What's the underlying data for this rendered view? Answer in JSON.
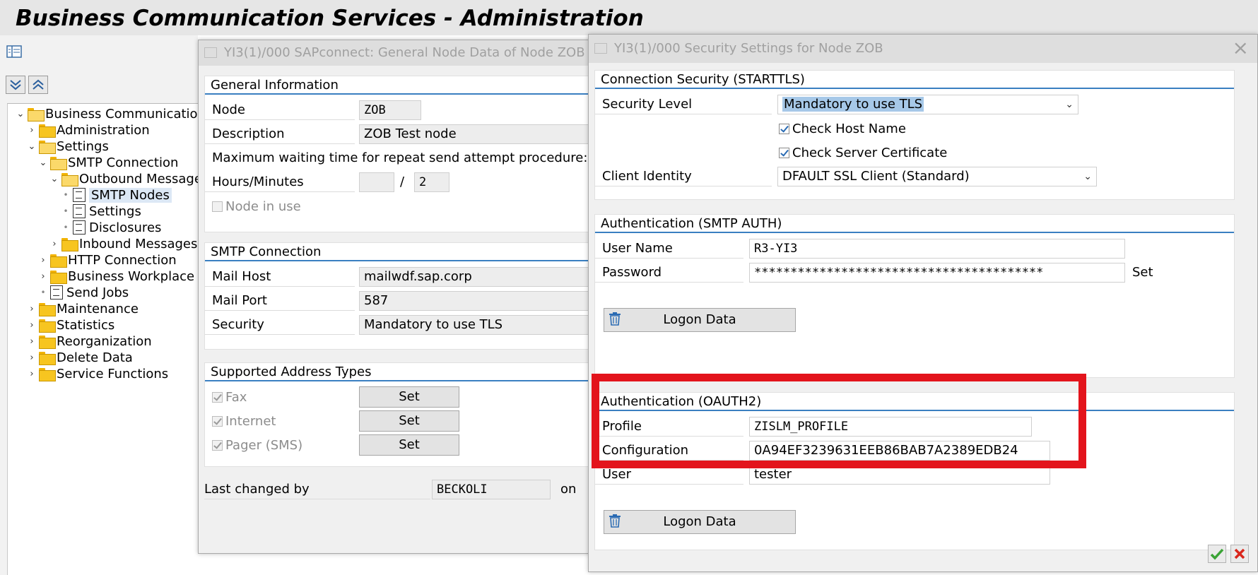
{
  "app": {
    "title": "Business Communication Services - Administration"
  },
  "tree": {
    "items": [
      {
        "label": "Business Communication",
        "toggle": "⌄",
        "icon": "folder-open-icon"
      },
      {
        "label": "Administration",
        "toggle": "›",
        "icon": "folder-icon"
      },
      {
        "label": "Settings",
        "toggle": "⌄",
        "icon": "folder-open-icon"
      },
      {
        "label": "SMTP Connection",
        "toggle": "⌄",
        "icon": "folder-open-icon"
      },
      {
        "label": "Outbound Messages",
        "toggle": "⌄",
        "icon": "folder-open-icon"
      },
      {
        "label": "SMTP Nodes",
        "toggle": "•",
        "icon": "document-icon"
      },
      {
        "label": "Settings",
        "toggle": "•",
        "icon": "document-icon"
      },
      {
        "label": "Disclosures",
        "toggle": "•",
        "icon": "document-icon"
      },
      {
        "label": "Inbound Messages",
        "toggle": "›",
        "icon": "folder-icon"
      },
      {
        "label": "HTTP Connection",
        "toggle": "›",
        "icon": "folder-icon"
      },
      {
        "label": "Business Workplace",
        "toggle": "›",
        "icon": "folder-icon"
      },
      {
        "label": "Send Jobs",
        "toggle": "•",
        "icon": "document-icon"
      },
      {
        "label": "Maintenance",
        "toggle": "›",
        "icon": "folder-icon"
      },
      {
        "label": "Statistics",
        "toggle": "›",
        "icon": "folder-icon"
      },
      {
        "label": "Reorganization",
        "toggle": "›",
        "icon": "folder-icon"
      },
      {
        "label": "Delete Data",
        "toggle": "›",
        "icon": "folder-icon"
      },
      {
        "label": "Service Functions",
        "toggle": "›",
        "icon": "folder-icon"
      }
    ]
  },
  "node_dialog": {
    "title": "YI3(1)/000 SAPconnect: General Node Data of Node ZOB",
    "general": {
      "title": "General Information",
      "node_label": "Node",
      "node_value": "ZOB",
      "description_label": "Description",
      "description_value": "ZOB Test node",
      "max_wait_text": "Maximum waiting time for repeat send attempt procedure:",
      "hours_minutes_label": "Hours/Minutes",
      "hours_value": "",
      "separator": "/",
      "minutes_value": "2",
      "node_in_use_label": "Node in use"
    },
    "smtp": {
      "title": "SMTP Connection",
      "mail_host_label": "Mail Host",
      "mail_host_value": "mailwdf.sap.corp",
      "mail_port_label": "Mail Port",
      "mail_port_value": "587",
      "security_label": "Security",
      "security_value": "Mandatory to use TLS"
    },
    "address_types": {
      "title": "Supported Address Types",
      "items": [
        {
          "label": "Fax",
          "button": "Set"
        },
        {
          "label": "Internet",
          "button": "Set"
        },
        {
          "label": "Pager (SMS)",
          "button": "Set"
        }
      ]
    },
    "last_changed_label": "Last changed by",
    "last_changed_value": "BECKOLI",
    "on_label": "on"
  },
  "security_dialog": {
    "title": "YI3(1)/000 Security Settings for Node ZOB",
    "close_label": "×",
    "starttls": {
      "title": "Connection Security (STARTTLS)",
      "security_level_label": "Security Level",
      "security_level_value": "Mandatory to use TLS",
      "check_host_label": "Check Host Name",
      "check_cert_label": "Check Server Certificate",
      "client_identity_label": "Client Identity",
      "client_identity_value": "DFAULT SSL Client (Standard)"
    },
    "smtp_auth": {
      "title": "Authentication (SMTP AUTH)",
      "user_name_label": "User Name",
      "user_name_value": "R3-YI3",
      "password_label": "Password",
      "password_value": "****************************************",
      "set_label": "Set",
      "logon_button": "Logon Data"
    },
    "oauth2": {
      "title": "Authentication (OAUTH2)",
      "profile_label": "Profile",
      "profile_value": "ZISLM_PROFILE",
      "configuration_label": "Configuration",
      "configuration_value": "0A94EF3239631EEB86BAB7A2389EDB24",
      "user_label": "User",
      "user_value": "tester",
      "logon_button": "Logon Data"
    }
  },
  "colors": {
    "highlight": "#e3141c",
    "accent_line": "#3a7fc1",
    "confirm": "#3aa335",
    "cancel": "#d9261c"
  }
}
